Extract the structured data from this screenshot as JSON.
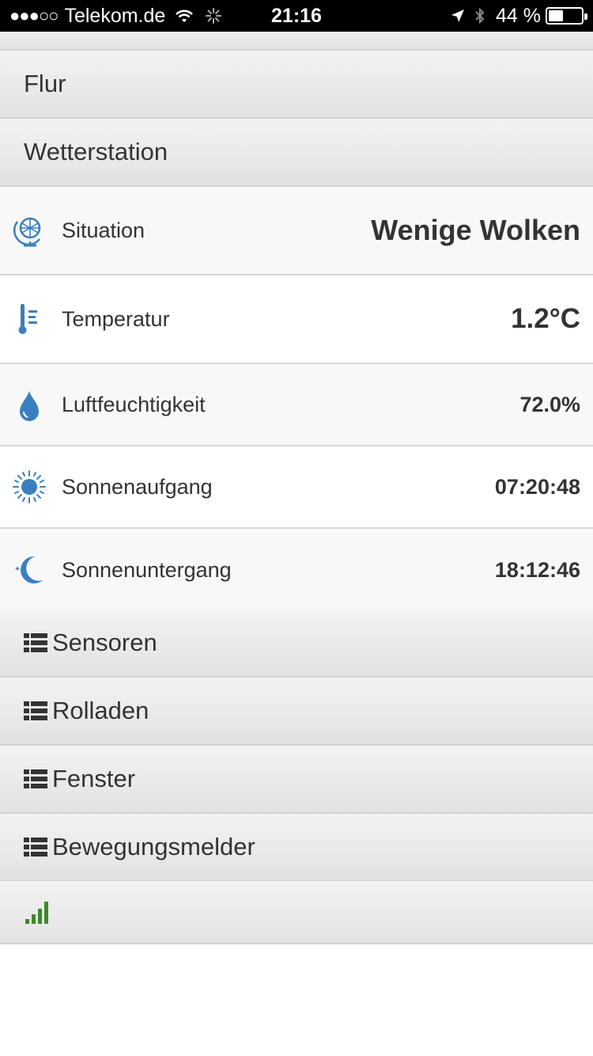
{
  "status_bar": {
    "signal_dots": "●●●○○",
    "carrier": "Telekom.de",
    "time": "21:16",
    "battery_text": "44 %",
    "battery_level": 0.44
  },
  "rooms": {
    "flur": "Flur",
    "wetterstation": "Wetterstation"
  },
  "weather": {
    "situation": {
      "label": "Situation",
      "value": "Wenige Wolken",
      "icon": "globe-icon"
    },
    "temperature": {
      "label": "Temperatur",
      "value": "1.2°C",
      "icon": "thermometer-icon"
    },
    "humidity": {
      "label": "Luftfeuchtigkeit",
      "value": "72.0%",
      "icon": "water-drop-icon"
    },
    "sunrise": {
      "label": "Sonnenaufgang",
      "value": "07:20:48",
      "icon": "sun-icon"
    },
    "sunset": {
      "label": "Sonnenuntergang",
      "value": "18:12:46",
      "icon": "moon-icon"
    }
  },
  "groups": {
    "sensoren": "Sensoren",
    "rolladen": "Rolladen",
    "fenster": "Fenster",
    "bewegungsmelder": "Bewegungsmelder"
  },
  "colors": {
    "accent_blue": "#3a7fc1",
    "signal_green": "#3b8a2a"
  }
}
